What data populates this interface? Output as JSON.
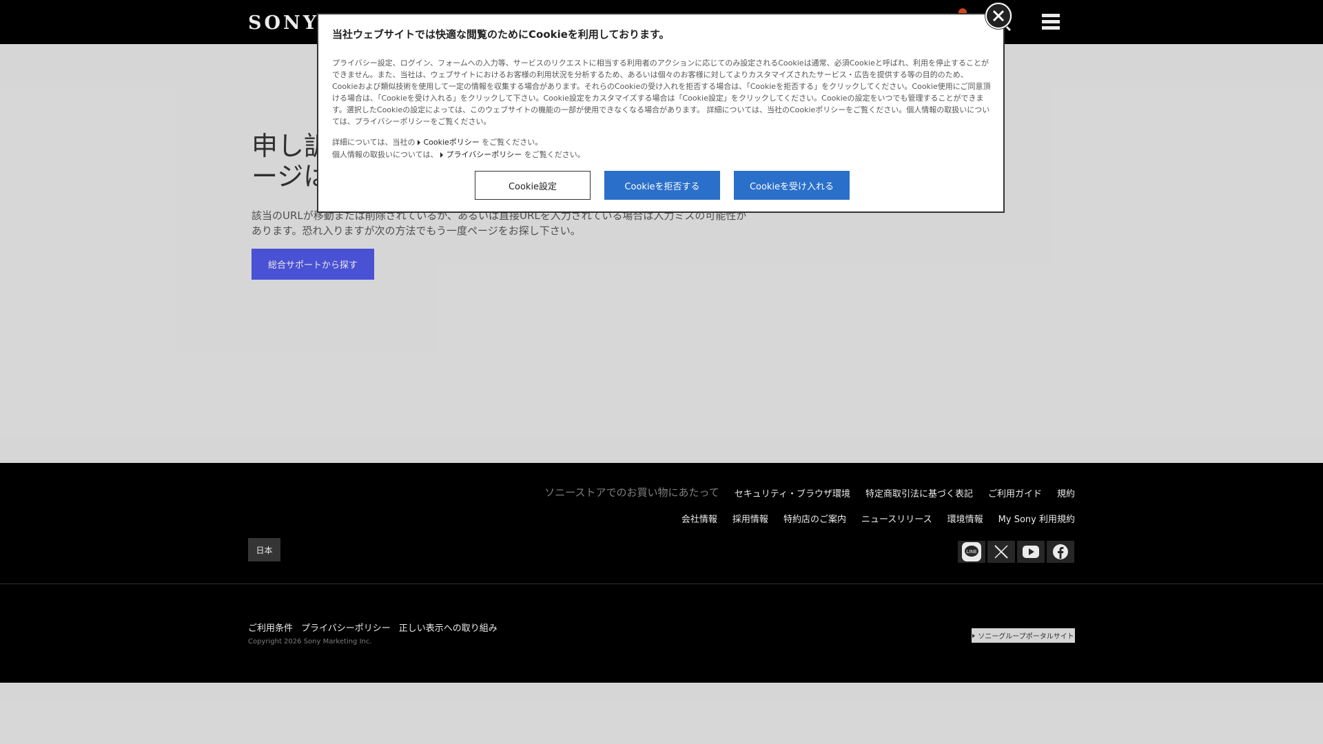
{
  "header": {
    "logo": "SONY"
  },
  "main": {
    "heading_line1": "申し訳",
    "heading_line2": "ージは",
    "description": "該当のURLが移動または削除されているか、あるいは直接URLを入力されている場合は入力ミスの可能性があります。恐れ入りますが次の方法でもう一度ページをお探し下さい。",
    "support_button": "総合サポートから探す"
  },
  "cookie": {
    "title": "当社ウェブサイトでは快適な閲覧のためにCookieを利用しております。",
    "body": "プライバシー設定、ログイン、フォームへの入力等、サービスのリクエストに相当する利用者のアクションに応じてのみ設定されるCookieは通常、必須Cookieと呼ばれ、利用を停止することができません。また、当社は、ウェブサイトにおけるお客様の利用状況を分析するため、あるいは個々のお客様に対してよりカスタマイズされたサービス・広告を提供する等の目的のため、Cookieおよび類似技術を使用して一定の情報を収集する場合があります。それらのCookieの受け入れを拒否する場合は、「Cookieを拒否する」をクリックしてください。Cookie使用にご同意頂ける場合は、「Cookieを受け入れる」をクリックして下さい。Cookie設定をカスタマイズする場合は「Cookie設定」をクリックしてください。Cookieの設定をいつでも管理することができます。選択したCookieの設定によっては、このウェブサイトの機能の一部が使用できなくなる場合があります。 詳細については、当社のCookieポリシーをご覧ください。個人情報の取扱いについては、プライバシーポリシーをご覧ください。",
    "detail_prefix": "詳細については、当社の",
    "cookie_policy_link": "Cookieポリシー",
    "detail_suffix": "をご覧ください。",
    "privacy_prefix": "個人情報の取扱いについては、",
    "privacy_link": "プライバシーポリシー",
    "privacy_suffix": "をご覧ください。",
    "settings_button": "Cookie設定",
    "reject_button": "Cookieを拒否する",
    "accept_button": "Cookieを受け入れる"
  },
  "footer": {
    "row1": [
      "ソニーストアでのお買い物にあたって",
      "セキュリティ・ブラウザ環境",
      "特定商取引法に基づく表記",
      "ご利用ガイド",
      "規約"
    ],
    "row2": [
      "会社情報",
      "採用情報",
      "特約店のご案内",
      "ニュースリリース",
      "環境情報",
      "My Sony 利用規約"
    ],
    "country": "日本",
    "social_line_label": "LINE",
    "legal": [
      "ご利用条件",
      "プライバシーポリシー",
      "正しい表示への取り組み"
    ],
    "copyright": "Copyright 2026 Sony Marketing Inc.",
    "portal": "ソニーグループポータルサイト"
  }
}
